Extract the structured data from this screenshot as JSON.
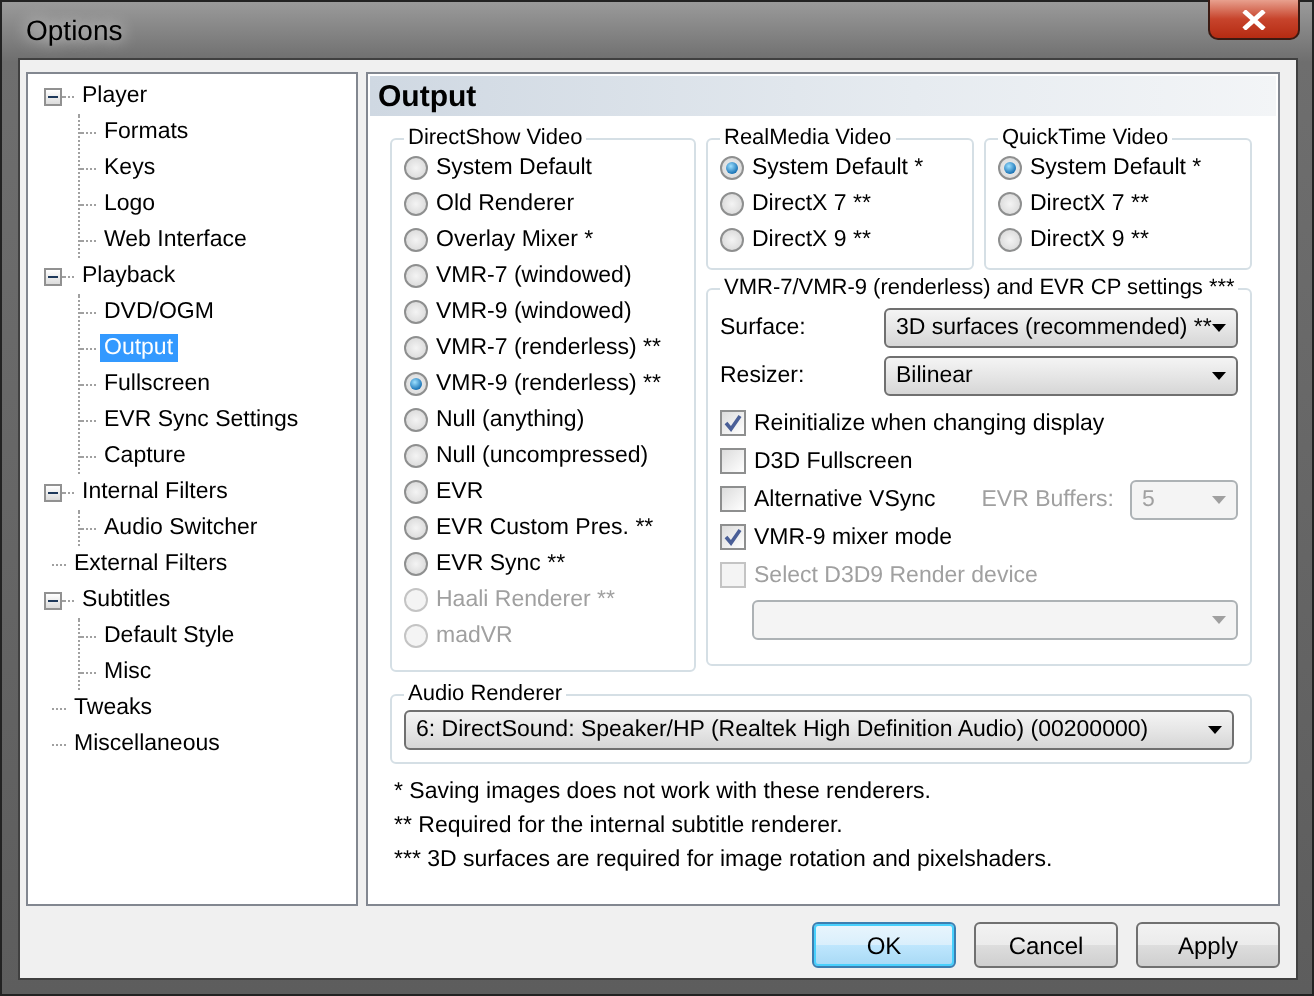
{
  "window": {
    "title": "Options"
  },
  "tree": [
    {
      "label": "Player",
      "expanded": true,
      "selected": false,
      "children": [
        {
          "label": "Formats",
          "selected": false
        },
        {
          "label": "Keys",
          "selected": false
        },
        {
          "label": "Logo",
          "selected": false
        },
        {
          "label": "Web Interface",
          "selected": false
        }
      ]
    },
    {
      "label": "Playback",
      "expanded": true,
      "selected": false,
      "children": [
        {
          "label": "DVD/OGM",
          "selected": false
        },
        {
          "label": "Output",
          "selected": true
        },
        {
          "label": "Fullscreen",
          "selected": false
        },
        {
          "label": "EVR Sync Settings",
          "selected": false
        },
        {
          "label": "Capture",
          "selected": false
        }
      ]
    },
    {
      "label": "Internal Filters",
      "expanded": true,
      "selected": false,
      "children": [
        {
          "label": "Audio Switcher",
          "selected": false
        }
      ]
    },
    {
      "label": "External Filters",
      "selected": false
    },
    {
      "label": "Subtitles",
      "expanded": true,
      "selected": false,
      "children": [
        {
          "label": "Default Style",
          "selected": false
        },
        {
          "label": "Misc",
          "selected": false
        }
      ]
    },
    {
      "label": "Tweaks",
      "selected": false
    },
    {
      "label": "Miscellaneous",
      "selected": false
    }
  ],
  "page": {
    "title": "Output"
  },
  "directshow": {
    "title": "DirectShow Video",
    "options": [
      {
        "label": "System Default",
        "selected": false,
        "disabled": false
      },
      {
        "label": "Old Renderer",
        "selected": false,
        "disabled": false
      },
      {
        "label": "Overlay Mixer *",
        "selected": false,
        "disabled": false
      },
      {
        "label": "VMR-7 (windowed)",
        "selected": false,
        "disabled": false
      },
      {
        "label": "VMR-9 (windowed)",
        "selected": false,
        "disabled": false
      },
      {
        "label": "VMR-7 (renderless) **",
        "selected": false,
        "disabled": false
      },
      {
        "label": "VMR-9 (renderless) **",
        "selected": true,
        "disabled": false
      },
      {
        "label": "Null (anything)",
        "selected": false,
        "disabled": false
      },
      {
        "label": "Null (uncompressed)",
        "selected": false,
        "disabled": false
      },
      {
        "label": "EVR",
        "selected": false,
        "disabled": false
      },
      {
        "label": "EVR Custom Pres. **",
        "selected": false,
        "disabled": false
      },
      {
        "label": "EVR Sync **",
        "selected": false,
        "disabled": false
      },
      {
        "label": "Haali Renderer **",
        "selected": false,
        "disabled": true
      },
      {
        "label": "madVR",
        "selected": false,
        "disabled": true
      }
    ]
  },
  "realmedia": {
    "title": "RealMedia Video",
    "options": [
      {
        "label": "System Default *",
        "selected": true,
        "disabled": false
      },
      {
        "label": "DirectX 7 **",
        "selected": false,
        "disabled": false
      },
      {
        "label": "DirectX 9 **",
        "selected": false,
        "disabled": false
      }
    ]
  },
  "quicktime": {
    "title": "QuickTime Video",
    "options": [
      {
        "label": "System Default *",
        "selected": true,
        "disabled": false
      },
      {
        "label": "DirectX 7 **",
        "selected": false,
        "disabled": false
      },
      {
        "label": "DirectX 9 **",
        "selected": false,
        "disabled": false
      }
    ]
  },
  "vmr_settings": {
    "title": "VMR-7/VMR-9 (renderless) and EVR CP settings ***",
    "selects": [
      {
        "label": "Surface:",
        "value": "3D surfaces (recommended) **"
      },
      {
        "label": "Resizer:",
        "value": "Bilinear"
      }
    ],
    "checkboxes": [
      {
        "label": "Reinitialize when changing display",
        "checked": true,
        "disabled": false
      },
      {
        "label": "D3D Fullscreen",
        "checked": false,
        "disabled": false
      },
      {
        "label": "Alternative VSync",
        "checked": false,
        "disabled": false,
        "buffers": {
          "label": "EVR Buffers:",
          "value": "5",
          "disabled": true
        }
      },
      {
        "label": "VMR-9 mixer mode",
        "checked": true,
        "disabled": false
      },
      {
        "label": "Select D3D9 Render device",
        "checked": false,
        "disabled": true
      }
    ],
    "device_select": {
      "disabled": true
    }
  },
  "audio_renderer": {
    "title": "Audio Renderer",
    "value": "6: DirectSound: Speaker/HP (Realtek High Definition Audio) (00200000)"
  },
  "notes": [
    "* Saving images does not work with these renderers.",
    "** Required for the internal subtitle renderer.",
    "*** 3D surfaces are required for image rotation and pixelshaders."
  ],
  "buttons": [
    {
      "label": "OK",
      "default": true
    },
    {
      "label": "Cancel",
      "default": false
    },
    {
      "label": "Apply",
      "default": false
    }
  ]
}
